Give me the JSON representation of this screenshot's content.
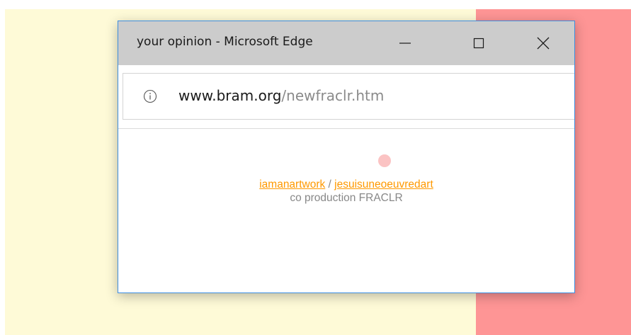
{
  "window": {
    "title": "your opinion - Microsoft Edge",
    "controls": [
      "minimize",
      "maximize",
      "close"
    ]
  },
  "address_bar": {
    "icon": "info-icon",
    "url_domain": "www.bram.org",
    "url_path": "/newfraclr.htm"
  },
  "content": {
    "link1": "iamanartwork",
    "separator": " / ",
    "link2": "jesuisuneoeuvredart",
    "credit": "co production FRACLR"
  },
  "colors": {
    "background_left": "#fefad7",
    "background_right": "#fe9595",
    "link": "#ff9900",
    "dot": "#fbc3c3",
    "window_border": "#3d8ee0",
    "titlebar": "#cccccc"
  }
}
